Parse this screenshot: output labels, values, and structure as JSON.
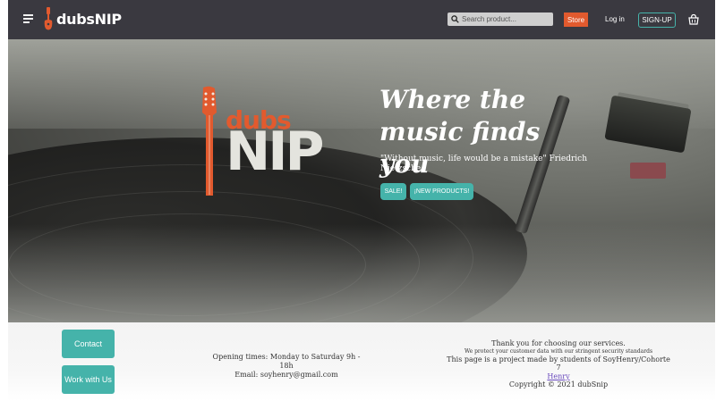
{
  "navbar": {
    "brand": "dubsNIP",
    "search_placeholder": "Search product...",
    "store_label": "Store",
    "login_label": "Log in",
    "signup_label": "SIGN-UP"
  },
  "hero": {
    "logo_top": "dubs",
    "logo_bottom": "NIP",
    "headline": "Where the music finds you",
    "quote": "\"Without music, life would be a mistake\" Friedrich Nietzsche.",
    "sale_label": "SALE!",
    "new_products_label": "¡NEW PRODUCTS!"
  },
  "footer": {
    "contact_label": "Contact",
    "work_label": "Work with Us",
    "opening_times": "Opening times: Monday to Saturday 9h - 18h",
    "email": "Email: soyhenry@gmail.com",
    "thanks": "Thank you for choosing our services.",
    "security": "We protect your customer data with our stringent security standards",
    "project": "This page is a project made by students of SoyHenry/Cohorte 7",
    "henry_link": "Henry",
    "copyright": "Copyright © 2021 dubSnip"
  },
  "colors": {
    "accent": "#45b3aa",
    "brand_orange": "#e25a2e",
    "navbar_bg": "#3a3940"
  }
}
